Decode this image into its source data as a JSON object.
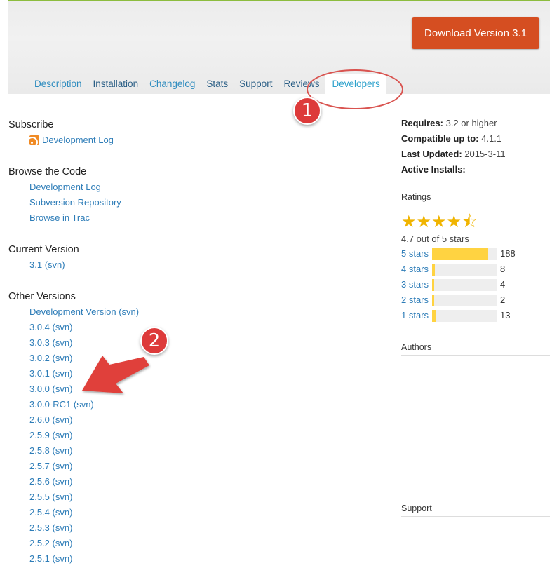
{
  "header": {
    "download_label": "Download Version 3.1",
    "tabs": [
      "Description",
      "Installation",
      "Changelog",
      "Stats",
      "Support",
      "Reviews",
      "Developers"
    ]
  },
  "annotations": {
    "badge1": "1",
    "badge2": "2"
  },
  "subscribe": {
    "title": "Subscribe",
    "link": "Development Log"
  },
  "browse": {
    "title": "Browse the Code",
    "links": [
      "Development Log",
      "Subversion Repository",
      "Browse in Trac"
    ]
  },
  "current": {
    "title": "Current Version",
    "version": "3.1",
    "svn": "(svn)"
  },
  "other": {
    "title": "Other Versions",
    "svn": "(svn)",
    "versions": [
      "Development Version",
      "3.0.4",
      "3.0.3",
      "3.0.2",
      "3.0.1",
      "3.0.0",
      "3.0.0-RC1",
      "2.6.0",
      "2.5.9",
      "2.5.8",
      "2.5.7",
      "2.5.6",
      "2.5.5",
      "2.5.4",
      "2.5.3",
      "2.5.2",
      "2.5.1"
    ]
  },
  "meta": {
    "requires_label": "Requires:",
    "requires": "3.2 or higher",
    "compatible_label": "Compatible up to:",
    "compatible": "4.1.1",
    "updated_label": "Last Updated:",
    "updated": "2015-3-11",
    "installs_label": "Active Installs:"
  },
  "ratings": {
    "title": "Ratings",
    "stars_display": "★★★★⯪",
    "summary": "4.7 out of 5 stars",
    "rows": [
      {
        "label": "5 stars",
        "count": "188",
        "fraction": 0.87
      },
      {
        "label": "4 stars",
        "count": "8",
        "fraction": 0.04
      },
      {
        "label": "3 stars",
        "count": "4",
        "fraction": 0.02
      },
      {
        "label": "2 stars",
        "count": "2",
        "fraction": 0.01
      },
      {
        "label": "1 stars",
        "count": "13",
        "fraction": 0.06
      }
    ]
  },
  "authors": {
    "title": "Authors"
  },
  "support": {
    "title": "Support"
  }
}
